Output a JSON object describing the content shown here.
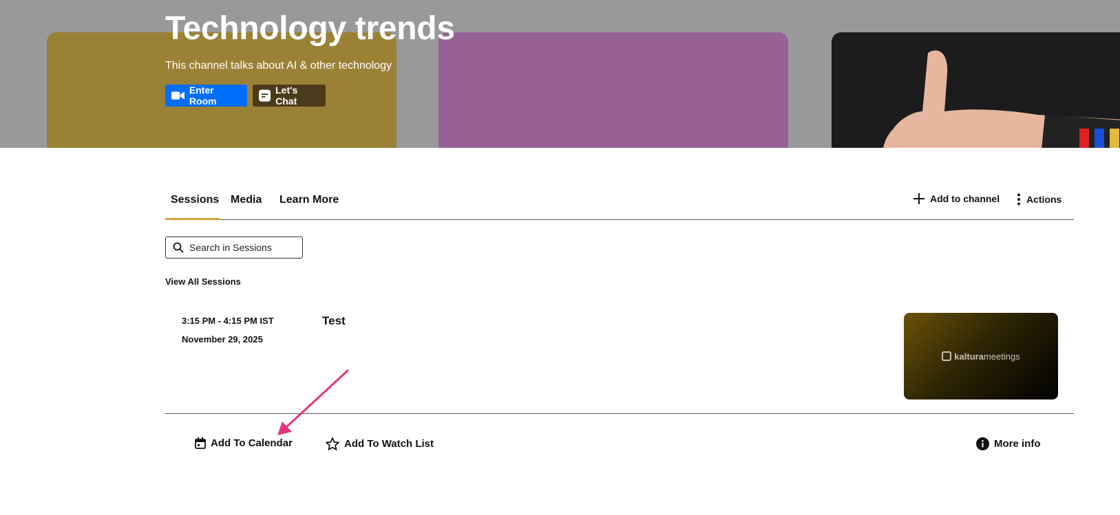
{
  "hero": {
    "title": "Technology trends",
    "subtitle": "This channel talks about AI & other technology",
    "enter_room_label": "Enter Room",
    "chat_label": "Let's Chat",
    "colors": {
      "overlay": "#999999",
      "enter": "#006efa",
      "chat": "#4b3b1a"
    }
  },
  "tabs": {
    "items": [
      "Sessions",
      "Media",
      "Learn More"
    ],
    "active": "Sessions",
    "add_label": "Add to channel",
    "actions_label": "Actions",
    "accent": "#e2a33b"
  },
  "search": {
    "placeholder": "Search in Sessions"
  },
  "view_all": "View All Sessions",
  "session": {
    "time": "3:15 PM - 4:15 PM IST",
    "date": "November 29, 2025",
    "title": "Test",
    "thumb_brand_bold": "kaltura",
    "thumb_brand_rest": "meetings"
  },
  "actions": {
    "calendar": "Add To Calendar",
    "watchlist": "Add To Watch List",
    "more_info": "More info"
  },
  "icons": [
    "video-icon",
    "chat-icon",
    "plus-icon",
    "kebab-icon",
    "search-icon",
    "calendar-icon",
    "star-icon",
    "info-icon"
  ]
}
